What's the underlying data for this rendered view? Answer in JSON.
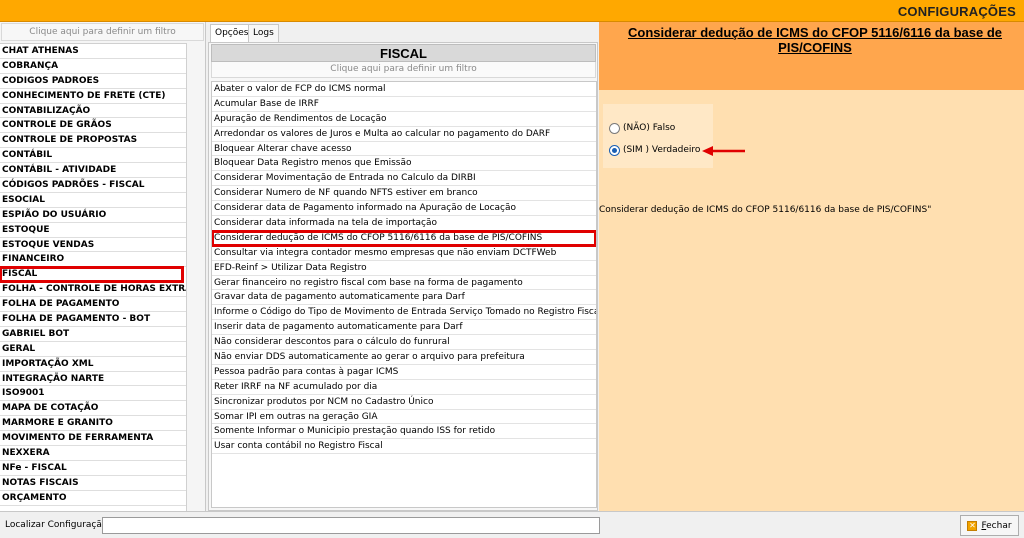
{
  "window": {
    "title": "CONFIGURAÇÕES"
  },
  "categories": {
    "filter_text": "Clique aqui para definir um filtro",
    "items": [
      "CHAT ATHENAS",
      "COBRANÇA",
      "CODIGOS PADROES",
      "CONHECIMENTO DE FRETE (CTE)",
      "CONTABILIZAÇÃO",
      "CONTROLE DE GRÃOS",
      "CONTROLE DE PROPOSTAS",
      "CONTÁBIL",
      "CONTÁBIL - ATIVIDADE",
      "CÓDIGOS PADRÕES - FISCAL",
      "ESOCIAL",
      "ESPIÃO DO USUÁRIO",
      "ESTOQUE",
      "ESTOQUE VENDAS",
      "FINANCEIRO",
      "FISCAL",
      "FOLHA - CONTROLE DE HORAS EXTRAS",
      "FOLHA DE PAGAMENTO",
      "FOLHA DE PAGAMENTO - BOT",
      "GABRIEL BOT",
      "GERAL",
      "IMPORTAÇÃO XML",
      "INTEGRAÇÃO NARTE",
      "ISO9001",
      "MAPA DE COTAÇÃO",
      "MARMORE E GRANITO",
      "MOVIMENTO DE FERRAMENTA",
      "NEXXERA",
      "NFe - FISCAL",
      "NOTAS FISCAIS",
      "ORÇAMENTO"
    ],
    "selected": "FISCAL"
  },
  "tabs": [
    {
      "label": "Opções",
      "active": true
    },
    {
      "label": "Logs",
      "active": false
    }
  ],
  "options": {
    "header": "FISCAL",
    "filter_text": "Clique aqui para definir um filtro",
    "items": [
      "Abater o valor de FCP do ICMS normal",
      "Acumular Base de IRRF",
      "Apuração de Rendimentos de Locação",
      "Arredondar os valores de Juros e Multa ao calcular no pagamento do DARF",
      "Bloquear Alterar chave acesso",
      "Bloquear Data Registro menos que Emissão",
      "Considerar Movimentação de Entrada no Calculo da DIRBI",
      "Considerar Numero de NF quando NFTS estiver em branco",
      "Considerar data de Pagamento informado na Apuração de Locação",
      "Considerar data informada na tela de importação",
      "Considerar dedução de ICMS do CFOP 5116/6116 da base de PIS/COFINS",
      "Consultar via integra contador mesmo empresas que não enviam DCTFWeb",
      "EFD-Reinf > Utilizar Data Registro",
      "Gerar financeiro no registro fiscal com base na forma de pagamento",
      "Gravar data de pagamento automaticamente para Darf",
      "Informe o Código do Tipo de Movimento de Entrada Serviço Tomado no Registro Fiscal",
      "Inserir data de pagamento automaticamente para Darf",
      "Não considerar descontos para o cálculo do funrural",
      "Não enviar DDS automaticamente ao gerar o arquivo para prefeitura",
      "Pessoa padrão para contas à pagar ICMS",
      "Reter IRRF na NF acumulado por dia",
      "Sincronizar produtos por NCM no Cadastro Único",
      "Somar IPI em outras na geração GIA",
      "Somente Informar o Municipio prestação quando ISS for retido",
      "Usar conta contábil no Registro Fiscal"
    ],
    "selected": "Considerar dedução de ICMS do CFOP 5116/6116 da base de PIS/COFINS"
  },
  "detail": {
    "title": "Considerar dedução de ICMS do CFOP 5116/6116 da base de PIS/COFINS",
    "radio_false": "(NÃO) Falso",
    "radio_true": "(SIM ) Verdadeiro",
    "selected_value": "true",
    "description": "Considerar dedução de ICMS do CFOP 5116/6116 da base de PIS/COFINS\""
  },
  "footer": {
    "search_label": "Localizar Configuração:",
    "search_value": "",
    "close_label": "Fechar",
    "close_icon": "close-icon"
  },
  "colors": {
    "topbar": "#ffa800",
    "detail_header": "#ffa64d",
    "detail_bg": "#ffdfb0",
    "highlight": "#e00000"
  }
}
